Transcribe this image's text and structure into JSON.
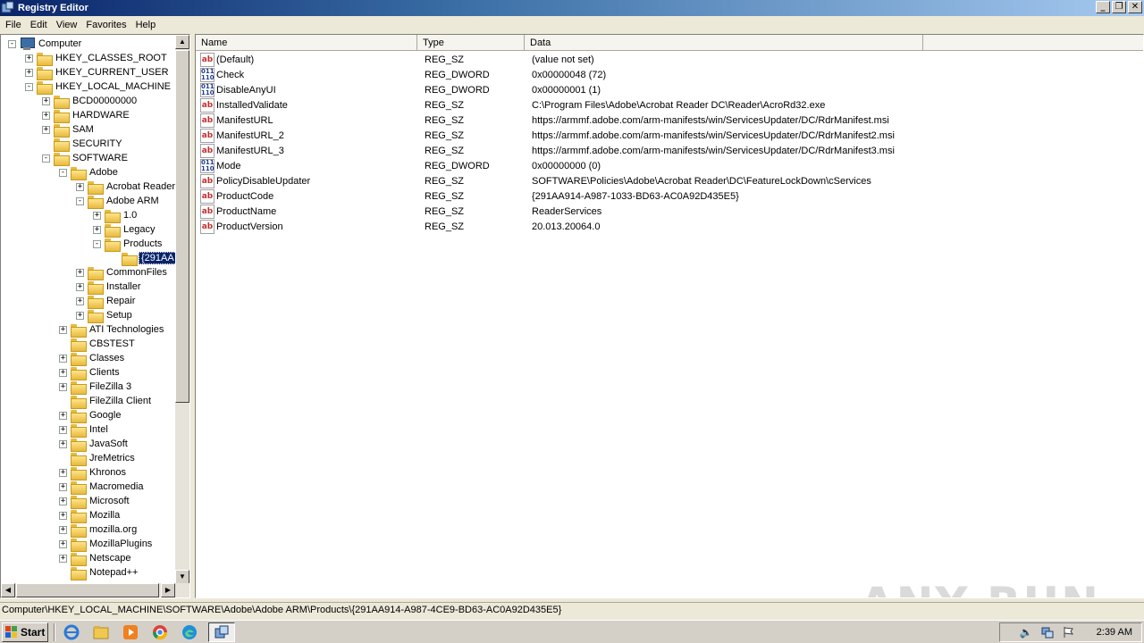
{
  "window": {
    "title": "Registry Editor",
    "controls": [
      "_",
      "❐",
      "✕"
    ]
  },
  "menu": [
    "File",
    "Edit",
    "View",
    "Favorites",
    "Help"
  ],
  "tree": [
    {
      "label": "Computer",
      "depth": 0,
      "exp": "-",
      "icon": "computer"
    },
    {
      "label": "HKEY_CLASSES_ROOT",
      "depth": 1,
      "exp": "+"
    },
    {
      "label": "HKEY_CURRENT_USER",
      "depth": 1,
      "exp": "+"
    },
    {
      "label": "HKEY_LOCAL_MACHINE",
      "depth": 1,
      "exp": "-"
    },
    {
      "label": "BCD00000000",
      "depth": 2,
      "exp": "+"
    },
    {
      "label": "HARDWARE",
      "depth": 2,
      "exp": "+"
    },
    {
      "label": "SAM",
      "depth": 2,
      "exp": "+"
    },
    {
      "label": "SECURITY",
      "depth": 2,
      "exp": ""
    },
    {
      "label": "SOFTWARE",
      "depth": 2,
      "exp": "-"
    },
    {
      "label": "Adobe",
      "depth": 3,
      "exp": "-"
    },
    {
      "label": "Acrobat Reader",
      "depth": 4,
      "exp": "+"
    },
    {
      "label": "Adobe ARM",
      "depth": 4,
      "exp": "-"
    },
    {
      "label": "1.0",
      "depth": 5,
      "exp": "+"
    },
    {
      "label": "Legacy",
      "depth": 5,
      "exp": "+"
    },
    {
      "label": "Products",
      "depth": 5,
      "exp": "-"
    },
    {
      "label": "{291AA",
      "depth": 6,
      "exp": "",
      "selected": true
    },
    {
      "label": "CommonFiles",
      "depth": 4,
      "exp": "+"
    },
    {
      "label": "Installer",
      "depth": 4,
      "exp": "+"
    },
    {
      "label": "Repair",
      "depth": 4,
      "exp": "+"
    },
    {
      "label": "Setup",
      "depth": 4,
      "exp": "+"
    },
    {
      "label": "ATI Technologies",
      "depth": 3,
      "exp": "+"
    },
    {
      "label": "CBSTEST",
      "depth": 3,
      "exp": ""
    },
    {
      "label": "Classes",
      "depth": 3,
      "exp": "+"
    },
    {
      "label": "Clients",
      "depth": 3,
      "exp": "+"
    },
    {
      "label": "FileZilla 3",
      "depth": 3,
      "exp": "+"
    },
    {
      "label": "FileZilla Client",
      "depth": 3,
      "exp": ""
    },
    {
      "label": "Google",
      "depth": 3,
      "exp": "+"
    },
    {
      "label": "Intel",
      "depth": 3,
      "exp": "+"
    },
    {
      "label": "JavaSoft",
      "depth": 3,
      "exp": "+"
    },
    {
      "label": "JreMetrics",
      "depth": 3,
      "exp": ""
    },
    {
      "label": "Khronos",
      "depth": 3,
      "exp": "+"
    },
    {
      "label": "Macromedia",
      "depth": 3,
      "exp": "+"
    },
    {
      "label": "Microsoft",
      "depth": 3,
      "exp": "+"
    },
    {
      "label": "Mozilla",
      "depth": 3,
      "exp": "+"
    },
    {
      "label": "mozilla.org",
      "depth": 3,
      "exp": "+"
    },
    {
      "label": "MozillaPlugins",
      "depth": 3,
      "exp": "+"
    },
    {
      "label": "Netscape",
      "depth": 3,
      "exp": "+"
    },
    {
      "label": "Notepad++",
      "depth": 3,
      "exp": ""
    }
  ],
  "columns": {
    "name": "Name",
    "type": "Type",
    "data": "Data"
  },
  "values": [
    {
      "name": "(Default)",
      "type": "REG_SZ",
      "data": "(value not set)",
      "kind": "sz"
    },
    {
      "name": "Check",
      "type": "REG_DWORD",
      "data": "0x00000048 (72)",
      "kind": "dw"
    },
    {
      "name": "DisableAnyUI",
      "type": "REG_DWORD",
      "data": "0x00000001 (1)",
      "kind": "dw"
    },
    {
      "name": "InstalledValidate",
      "type": "REG_SZ",
      "data": "C:\\Program Files\\Adobe\\Acrobat Reader DC\\Reader\\AcroRd32.exe",
      "kind": "sz"
    },
    {
      "name": "ManifestURL",
      "type": "REG_SZ",
      "data": "https://armmf.adobe.com/arm-manifests/win/ServicesUpdater/DC/RdrManifest.msi",
      "kind": "sz"
    },
    {
      "name": "ManifestURL_2",
      "type": "REG_SZ",
      "data": "https://armmf.adobe.com/arm-manifests/win/ServicesUpdater/DC/RdrManifest2.msi",
      "kind": "sz"
    },
    {
      "name": "ManifestURL_3",
      "type": "REG_SZ",
      "data": "https://armmf.adobe.com/arm-manifests/win/ServicesUpdater/DC/RdrManifest3.msi",
      "kind": "sz"
    },
    {
      "name": "Mode",
      "type": "REG_DWORD",
      "data": "0x00000000 (0)",
      "kind": "dw"
    },
    {
      "name": "PolicyDisableUpdater",
      "type": "REG_SZ",
      "data": "SOFTWARE\\Policies\\Adobe\\Acrobat Reader\\DC\\FeatureLockDown\\cServices",
      "kind": "sz"
    },
    {
      "name": "ProductCode",
      "type": "REG_SZ",
      "data": "{291AA914-A987-1033-BD63-AC0A92D435E5}",
      "kind": "sz"
    },
    {
      "name": "ProductName",
      "type": "REG_SZ",
      "data": "ReaderServices",
      "kind": "sz"
    },
    {
      "name": "ProductVersion",
      "type": "REG_SZ",
      "data": "20.013.20064.0",
      "kind": "sz"
    }
  ],
  "icon_glyphs": {
    "sz": "ab",
    "dw": "011\n110"
  },
  "status": "Computer\\HKEY_LOCAL_MACHINE\\SOFTWARE\\Adobe\\Adobe ARM\\Products\\{291AA914-A987-4CE9-BD63-AC0A92D435E5}",
  "watermark": "ANY RUN",
  "taskbar": {
    "start": "Start",
    "clock": "2:39 AM",
    "apps": [
      "ie-icon",
      "explorer-icon",
      "media-player-icon",
      "chrome-icon",
      "edge-icon",
      "regedit-icon"
    ]
  }
}
